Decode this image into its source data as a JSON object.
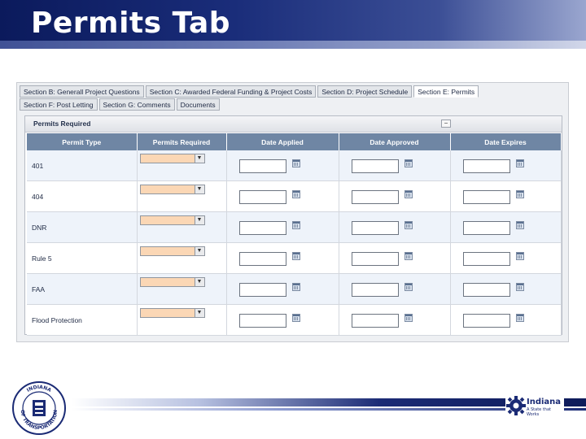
{
  "slide": {
    "title": "Permits Tab"
  },
  "tabs_row1": [
    {
      "label": "Section B: Generall Project Questions",
      "active": false
    },
    {
      "label": "Section C: Awarded Federal Funding & Project Costs",
      "active": false
    },
    {
      "label": "Section D: Project Schedule",
      "active": false
    },
    {
      "label": "Section E: Permits",
      "active": true
    }
  ],
  "tabs_row2": [
    {
      "label": "Section F: Post Letting",
      "active": false
    },
    {
      "label": "Section G: Comments",
      "active": false
    },
    {
      "label": "Documents",
      "active": false
    }
  ],
  "panel": {
    "title": "Permits Required",
    "collapse_symbol": "−"
  },
  "table": {
    "headers": [
      "Permit Type",
      "Permits Required",
      "Date Applied",
      "Date Approved",
      "Date Expires"
    ],
    "rows": [
      {
        "permit_type": "401"
      },
      {
        "permit_type": "404"
      },
      {
        "permit_type": "DNR"
      },
      {
        "permit_type": "Rule 5"
      },
      {
        "permit_type": "FAA"
      },
      {
        "permit_type": "Flood Protection"
      }
    ],
    "select_arrow": "▼"
  },
  "footer": {
    "seal_text_top": "INDIANA",
    "seal_text_left": "DEPARTMENT",
    "seal_text_bottom": "OF TRANSPORTATION",
    "brand_name": "Indiana",
    "brand_tagline": "A State that Works",
    "colors": {
      "navy": "#1b2b75",
      "header_blue": "#6f86a4",
      "select_fill": "#fbd7b5"
    }
  }
}
